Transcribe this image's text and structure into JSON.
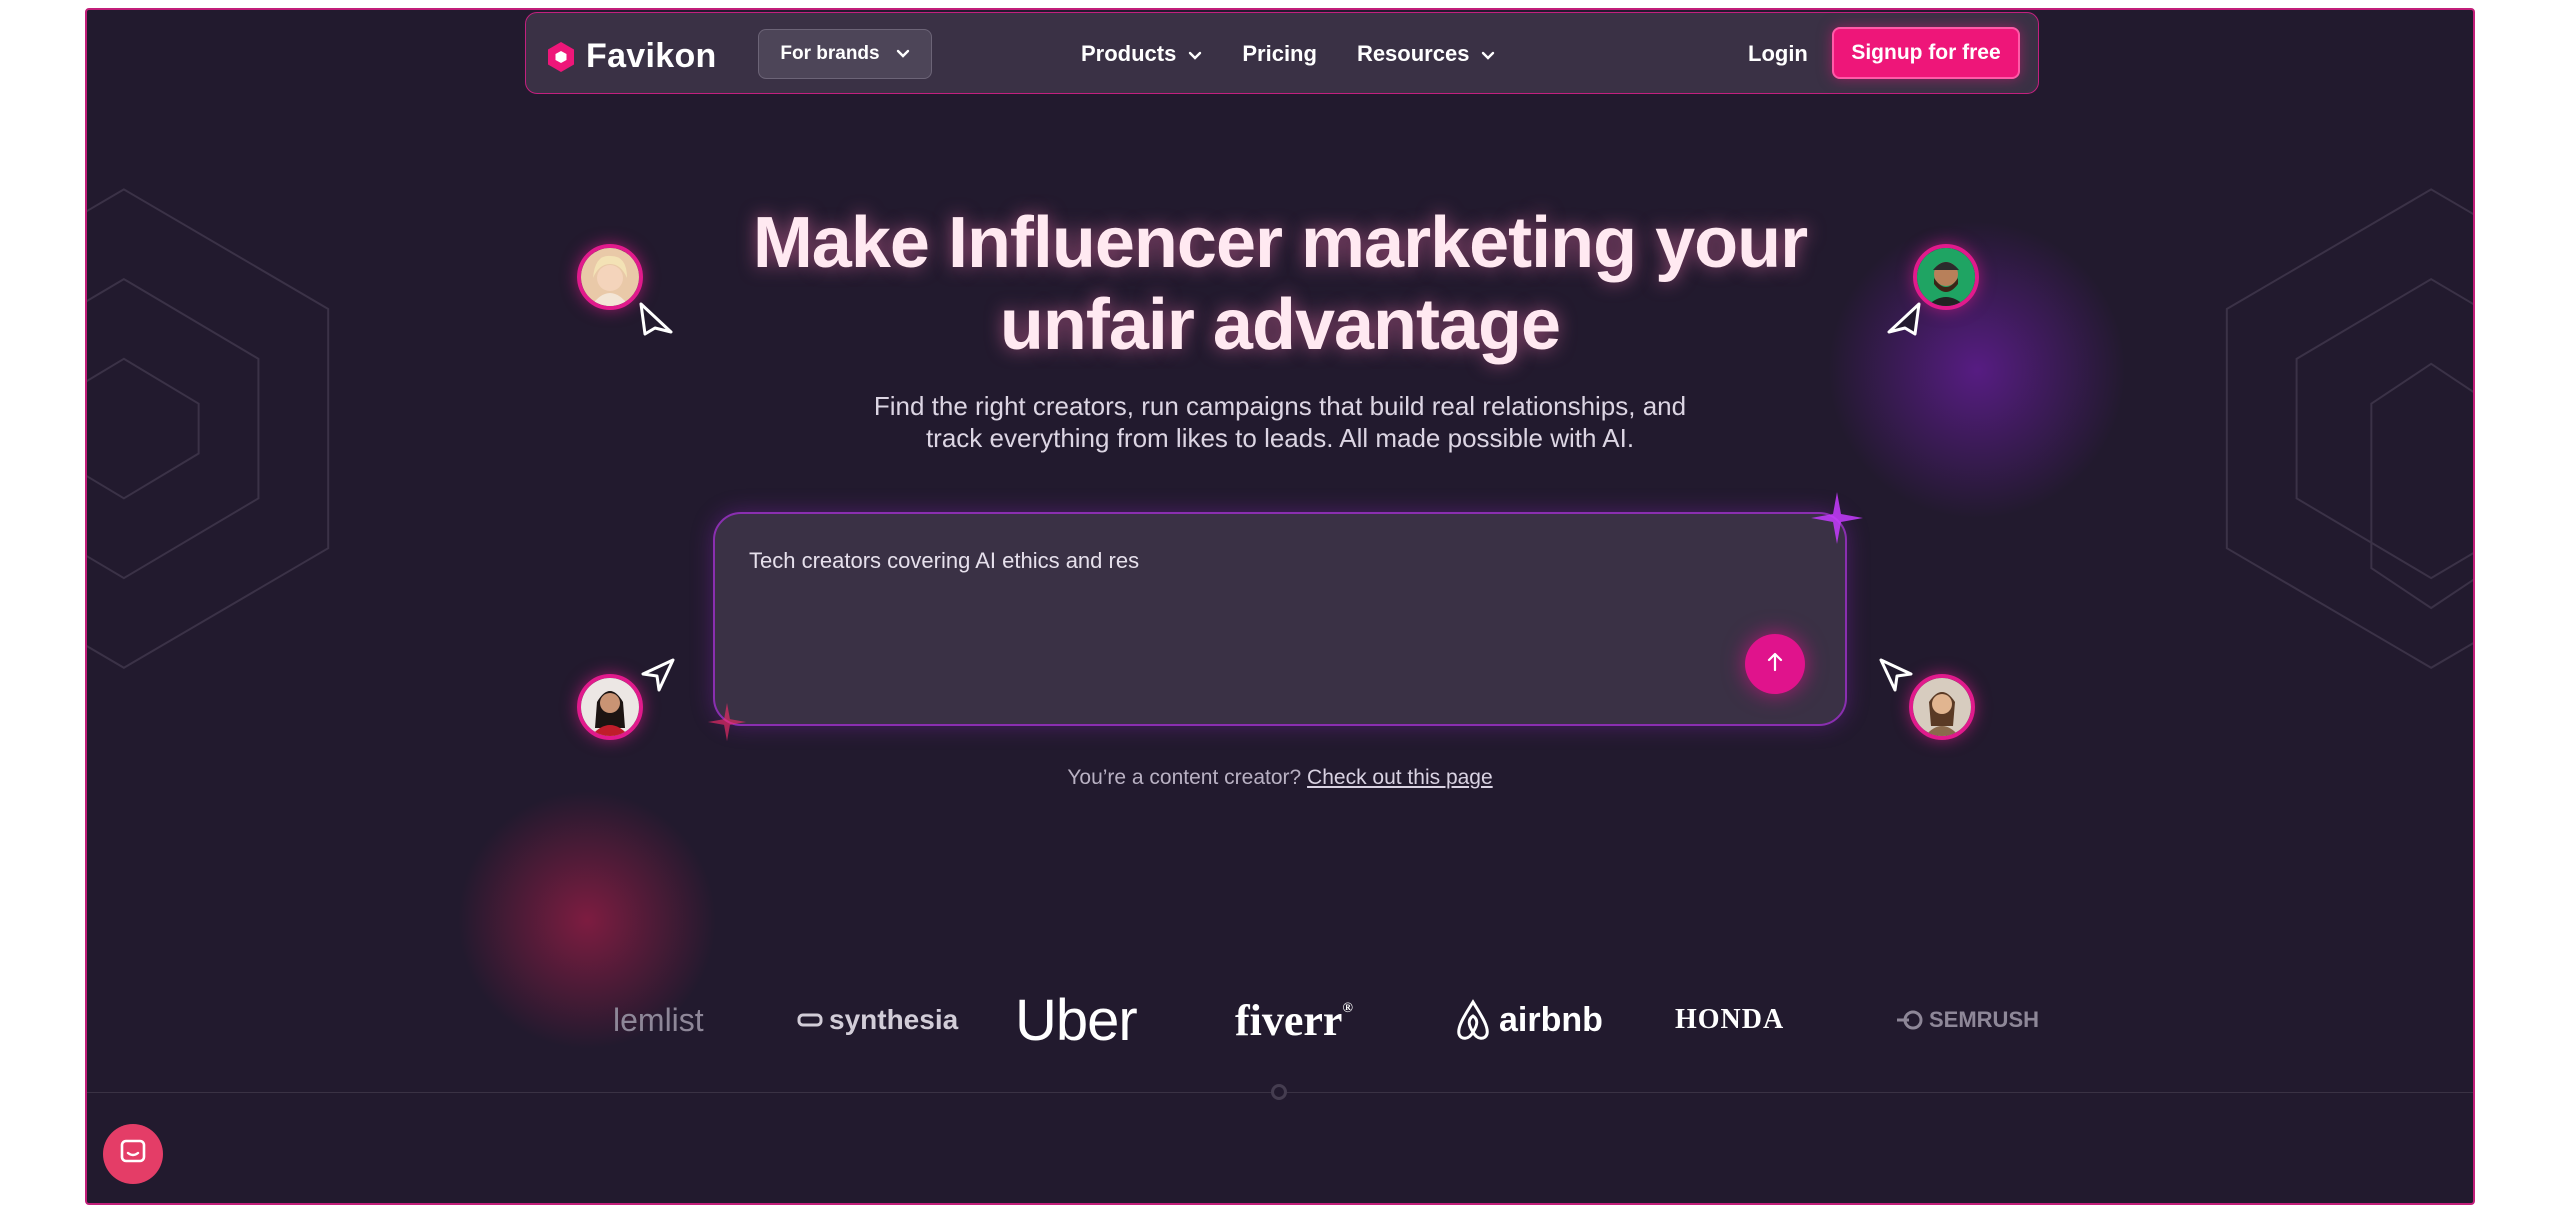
{
  "brand": {
    "name": "Favikon"
  },
  "nav": {
    "audience_select": "For brands",
    "links": [
      {
        "label": "Products",
        "has_dropdown": true
      },
      {
        "label": "Pricing",
        "has_dropdown": false
      },
      {
        "label": "Resources",
        "has_dropdown": true
      }
    ],
    "login_label": "Login",
    "signup_label": "Signup for free"
  },
  "hero": {
    "headline_line1": "Make Influencer marketing your",
    "headline_line2": "unfair advantage",
    "subline_line1": "Find the right creators, run campaigns that build real relationships, and",
    "subline_line2": "track everything from likes to leads. All made possible with AI."
  },
  "search": {
    "typed_text": "Tech creators covering AI ethics and res",
    "send_icon": "arrow-up-icon"
  },
  "creator_note": {
    "text": "You’re a content creator?",
    "link_label": "Check out this page"
  },
  "brand_logos": [
    "lemlist",
    "synthesia",
    "Uber",
    "fiverr",
    "airbnb",
    "HONDA",
    "SEMRUSH"
  ],
  "colors": {
    "background": "#221a2e",
    "accent": "#ee1679",
    "frame_border": "#c21f7a",
    "nav_bg": "#3a3145"
  },
  "chat_widget": {
    "icon": "chat-icon"
  }
}
